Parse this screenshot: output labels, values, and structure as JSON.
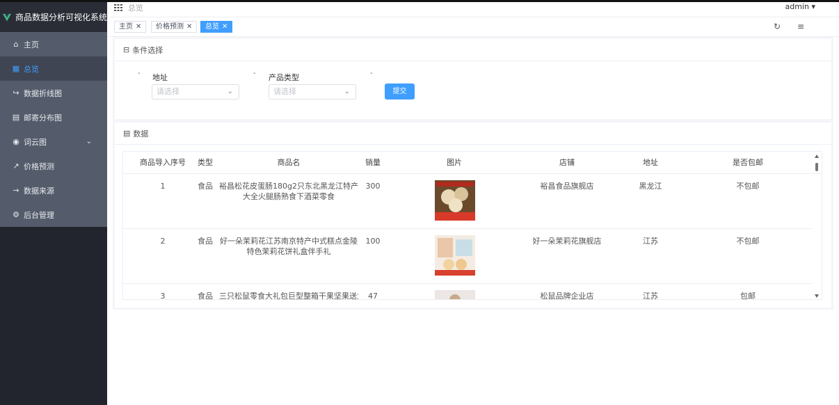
{
  "app": {
    "title": "商品数据分析可视化系统"
  },
  "colors": {
    "accent": "#409eff",
    "sidebar_bg": "#545c6b",
    "sidebar_dark": "#22252e"
  },
  "sidebar": {
    "items": [
      {
        "label": "主页",
        "icon": "home-icon"
      },
      {
        "label": "总览",
        "icon": "grid-icon",
        "active": true
      },
      {
        "label": "数据折线图",
        "icon": "key-icon"
      },
      {
        "label": "邮寄分布图",
        "icon": "clipboard-icon"
      },
      {
        "label": "词云图",
        "icon": "eye-icon",
        "has_submenu": true
      },
      {
        "label": "价格预测",
        "icon": "trend-icon"
      },
      {
        "label": "数据来源",
        "icon": "arrow-right-icon"
      },
      {
        "label": "后台管理",
        "icon": "gear-icon"
      }
    ]
  },
  "header": {
    "breadcrumb": "总览",
    "user": "admin"
  },
  "tags": [
    {
      "label": "主页"
    },
    {
      "label": "价格预测"
    },
    {
      "label": "总览",
      "active": true
    }
  ],
  "filter": {
    "title": "条件选择",
    "address_label": "地址",
    "type_label": "产品类型",
    "address_placeholder": "请选择",
    "type_placeholder": "请选择",
    "submit_label": "提交"
  },
  "data_card": {
    "title": "数据",
    "columns": [
      "商品导入序号",
      "类型",
      "商品名",
      "销量",
      "图片",
      "店铺",
      "地址",
      "是否包邮"
    ],
    "rows": [
      {
        "index": "1",
        "type": "食品",
        "name": "裕昌松花皮蛋肠180g2只东北黑龙江特产大全火腿肠熟食下酒菜零食",
        "sales": "300",
        "shop": "裕昌食品旗舰店",
        "address": "黑龙江",
        "shipping": "不包邮"
      },
      {
        "index": "2",
        "type": "食品",
        "name": "好一朵茉莉花江苏南京特产中式糕点金陵特色茉莉花饼礼盒伴手礼",
        "sales": "100",
        "shop": "好一朵茉莉花旗舰店",
        "address": "江苏",
        "shipping": "不包邮"
      },
      {
        "index": "3",
        "type": "食品",
        "name": "三只松鼠零食大礼包巨型整箱干果坚果送女友",
        "sales": "47",
        "shop": "松鼠品牌企业店",
        "address": "江苏",
        "shipping": "包邮"
      }
    ]
  }
}
